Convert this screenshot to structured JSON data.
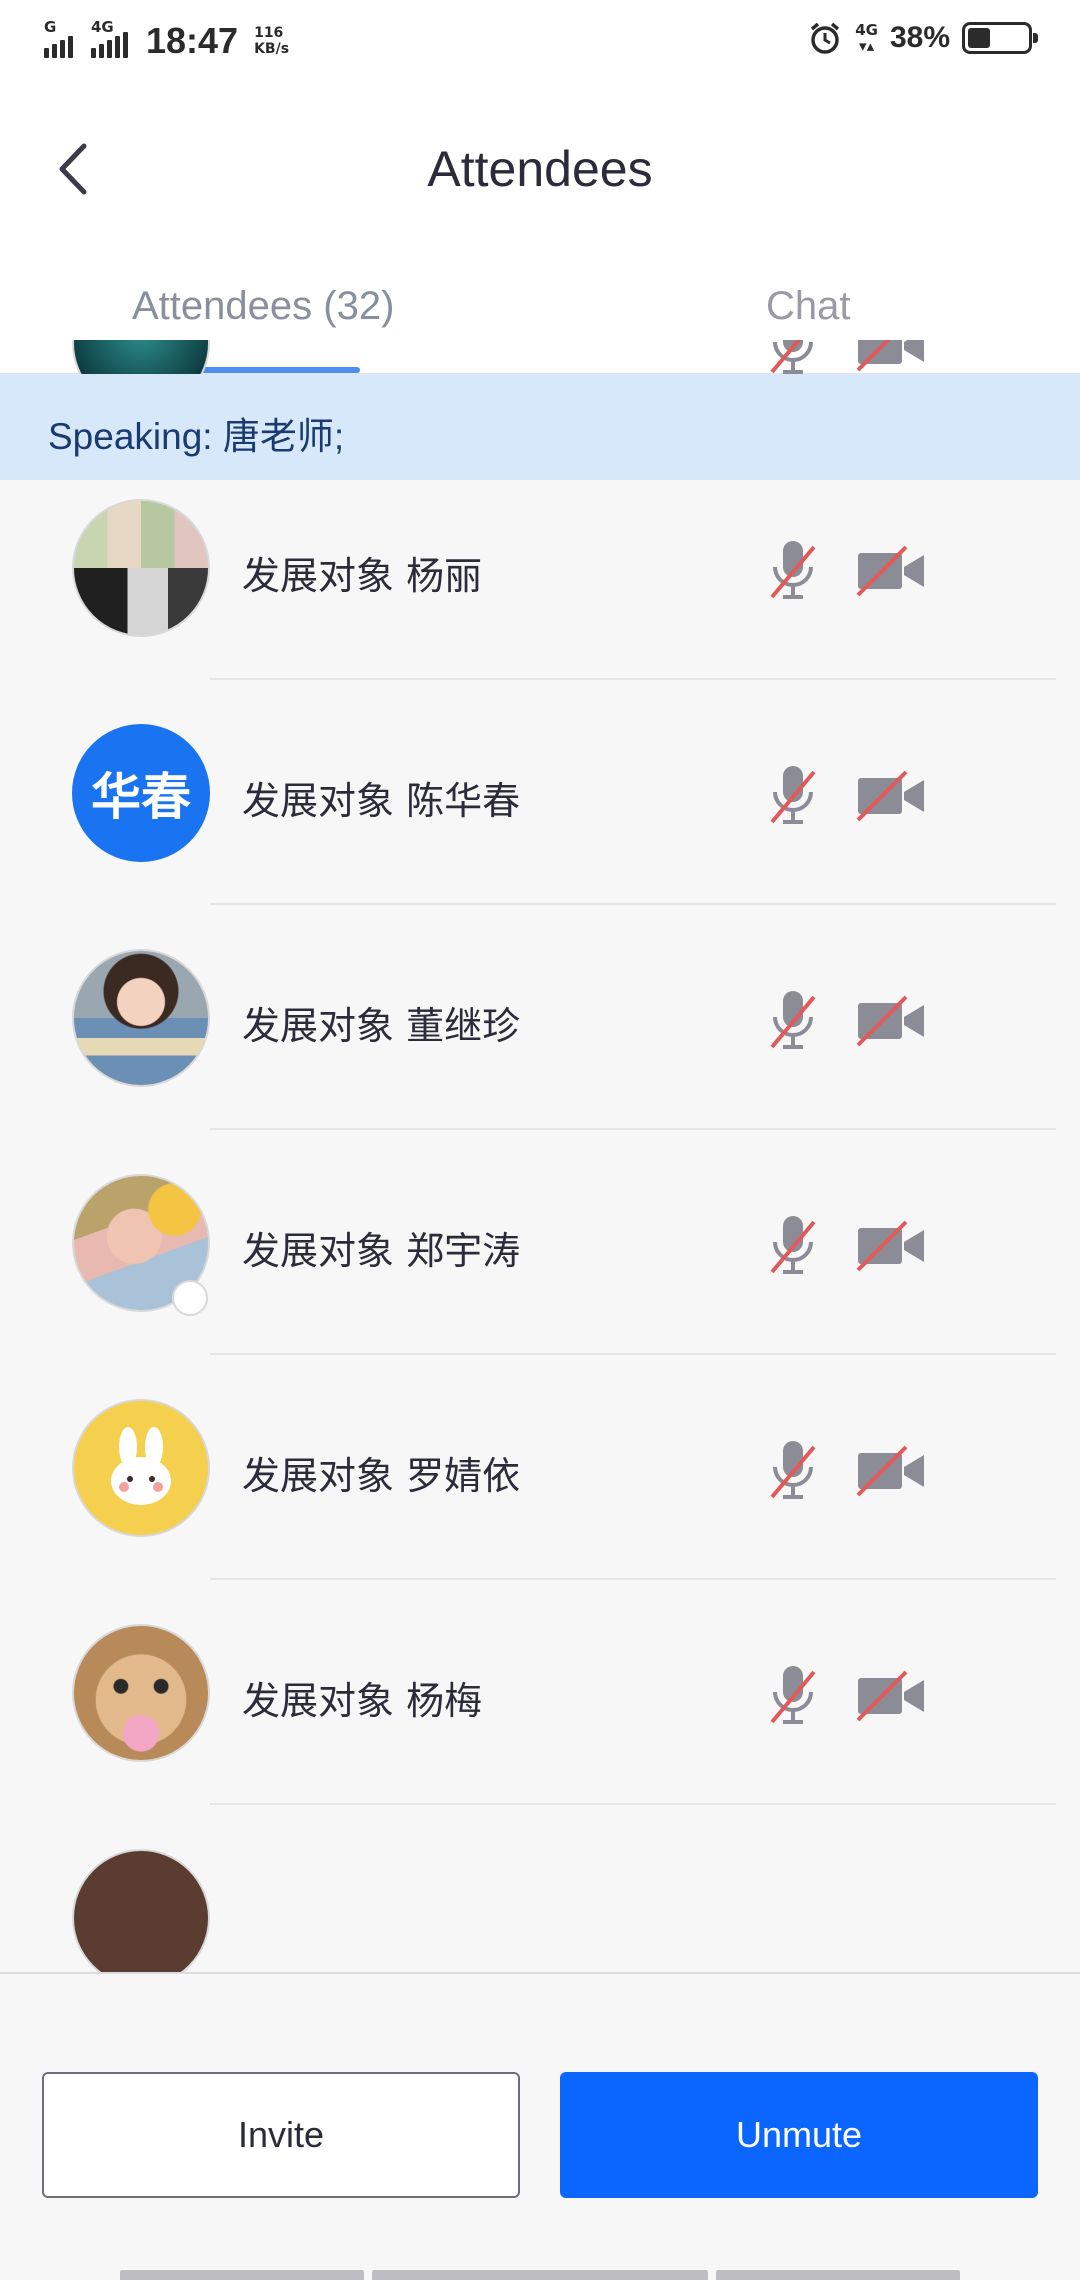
{
  "status_bar": {
    "time": "18:47",
    "speed_value": "116",
    "speed_unit": "KB/s",
    "network_left": "4G",
    "network_right": "4G",
    "signal_label": "G",
    "battery_percent": "38%",
    "battery_level": 0.38,
    "icons": [
      "signal-icon",
      "signal-icon",
      "alarm-icon",
      "battery-icon"
    ]
  },
  "header": {
    "title": "Attendees",
    "back_icon": "back-arrow-icon"
  },
  "tabs": [
    {
      "label": "Attendees (32)",
      "selected": true
    },
    {
      "label": "Chat",
      "selected": false
    }
  ],
  "speaking": {
    "text": "Speaking: 唐老师;"
  },
  "attendees": [
    {
      "name": "",
      "avatar": "photo",
      "mic": "muted",
      "camera": "off"
    },
    {
      "name": "发展对象  杨丽",
      "avatar": "photo",
      "mic": "muted",
      "camera": "off"
    },
    {
      "name": "发展对象 陈华春",
      "avatar": "initials",
      "initials": "华春",
      "mic": "muted",
      "camera": "off"
    },
    {
      "name": "发展对象 董继珍",
      "avatar": "photo",
      "mic": "muted",
      "camera": "off"
    },
    {
      "name": "发展对象 郑宇涛",
      "avatar": "photo",
      "mic": "muted",
      "camera": "off",
      "signal_badge": true
    },
    {
      "name": "发展对象 罗婧依",
      "avatar": "photo",
      "mic": "muted",
      "camera": "off"
    },
    {
      "name": "发展对象 杨梅",
      "avatar": "photo",
      "mic": "muted",
      "camera": "off"
    },
    {
      "name": "",
      "avatar": "photo",
      "mic": "muted",
      "camera": "off"
    }
  ],
  "buttons": {
    "invite": "Invite",
    "unmute": "Unmute"
  },
  "colors": {
    "accent": "#0a66ff",
    "speaking_bg": "#d7e8fb",
    "tab_indicator": "#4d8ff0",
    "muted_slash": "#e05a5a",
    "icon_gray": "#8c8c96"
  }
}
